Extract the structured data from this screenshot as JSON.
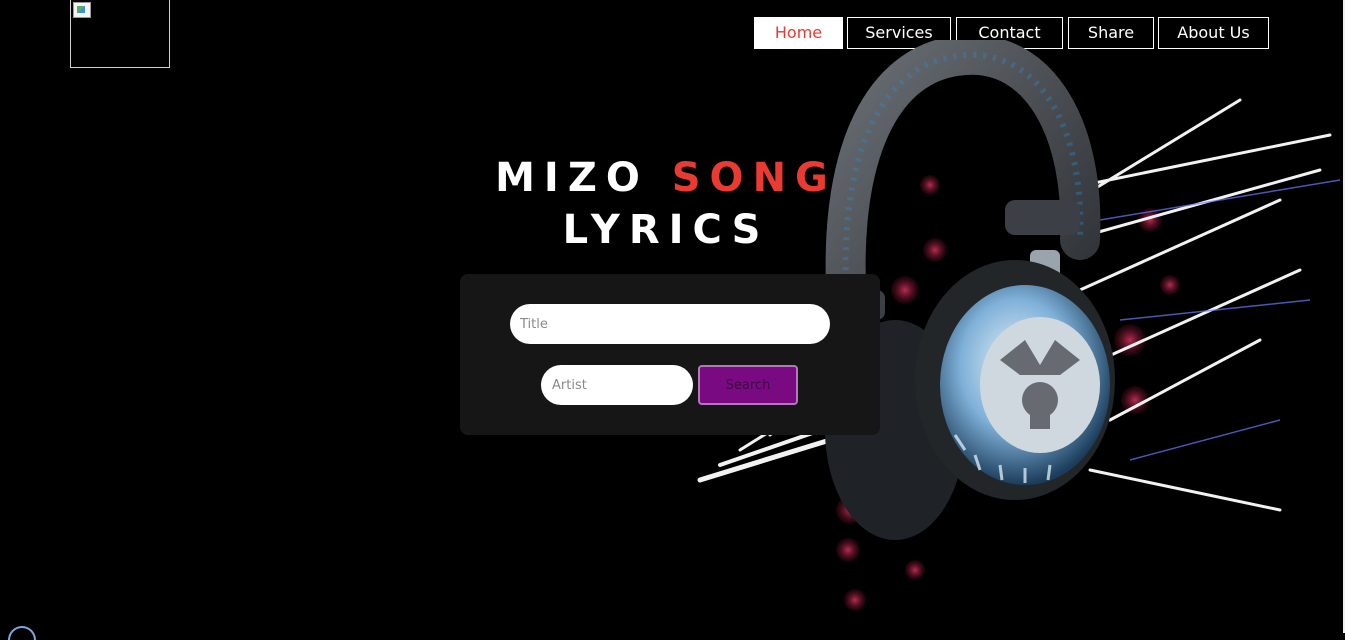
{
  "logo": {
    "alt_icon": "broken-image-icon"
  },
  "nav": {
    "items": [
      {
        "label": "Home",
        "active": true
      },
      {
        "label": "Services"
      },
      {
        "label": "Contact"
      },
      {
        "label": "Share"
      },
      {
        "label": "About Us"
      }
    ]
  },
  "hero": {
    "title_part1": "MIZO ",
    "title_accent": "SONG",
    "title_part2": "LYRICS",
    "accent_color": "#ea3b32",
    "image_icon": "headphones-icon"
  },
  "search": {
    "title_placeholder": "Title",
    "artist_placeholder": "Artist",
    "button_label": "Search",
    "button_color": "#7a0a82"
  }
}
